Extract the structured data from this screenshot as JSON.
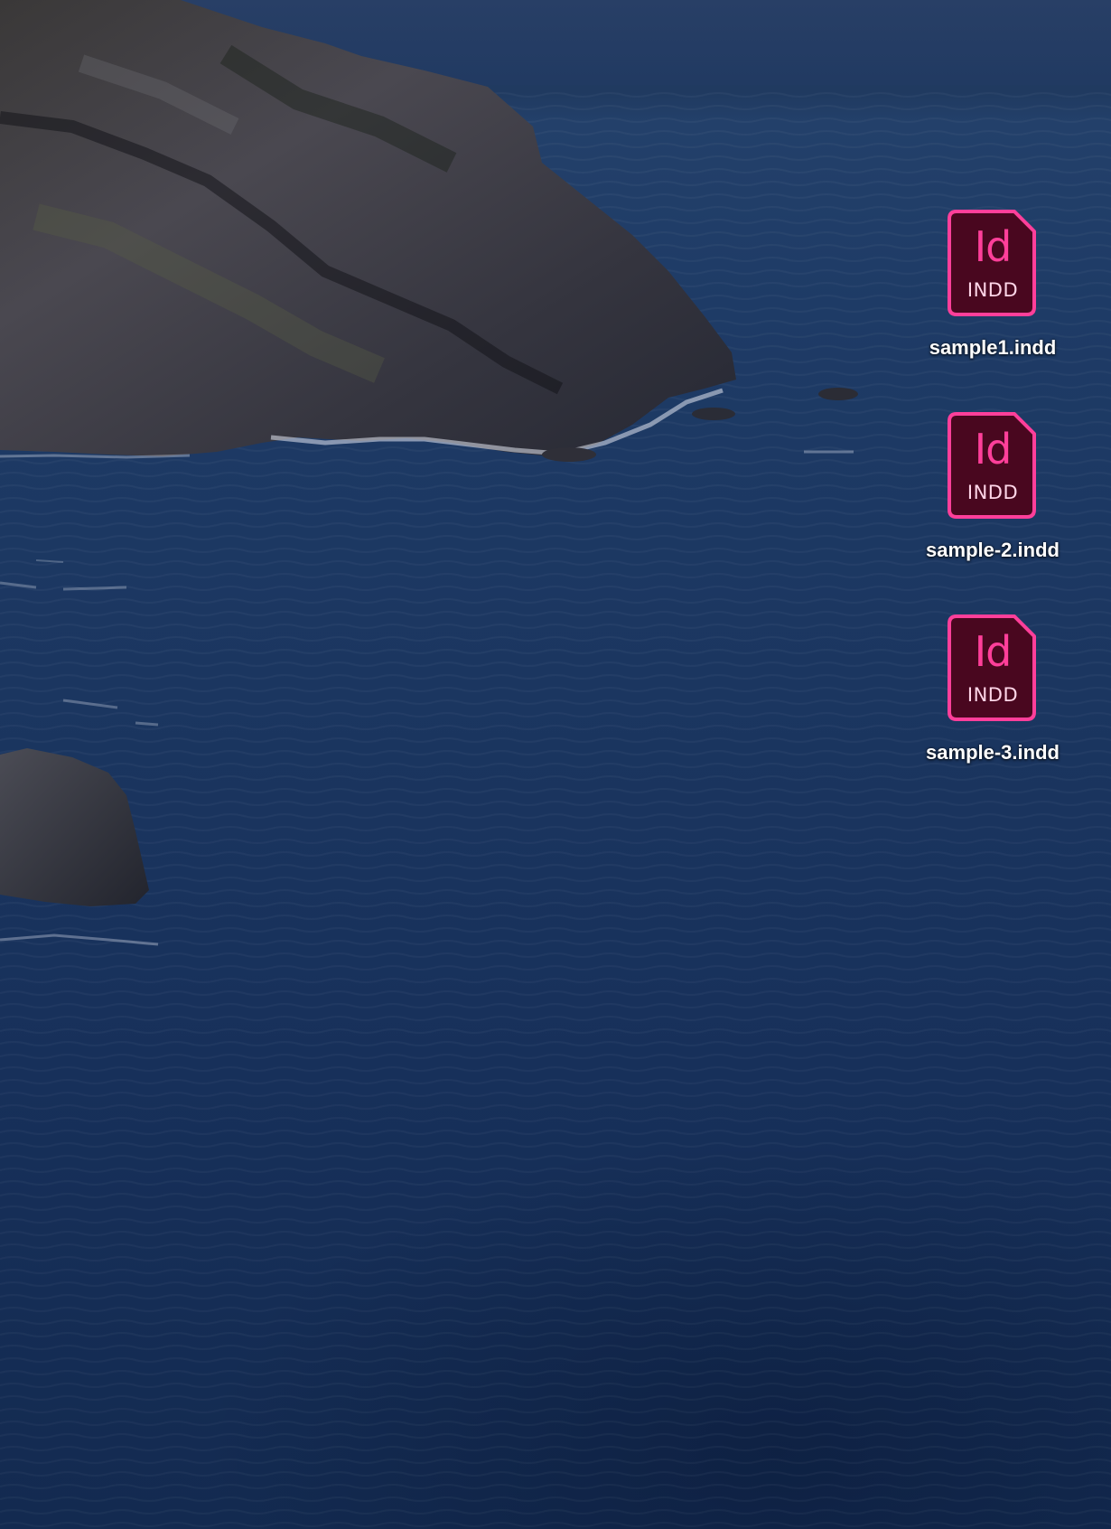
{
  "desktop": {
    "icons": [
      {
        "name": "sample1.indd",
        "app_badge": "Id",
        "type_label": "INDD",
        "icon": "indesign-document-icon"
      },
      {
        "name": "sample-2.indd",
        "app_badge": "Id",
        "type_label": "INDD",
        "icon": "indesign-document-icon"
      },
      {
        "name": "sample-3.indd",
        "app_badge": "Id",
        "type_label": "INDD",
        "icon": "indesign-document-icon"
      }
    ]
  },
  "colors": {
    "icon_fill": "#49071f",
    "icon_border": "#ff3f9a",
    "icon_letters": "#ff3f9a",
    "sea": "#1b3660",
    "rock": "#3c3b45"
  }
}
